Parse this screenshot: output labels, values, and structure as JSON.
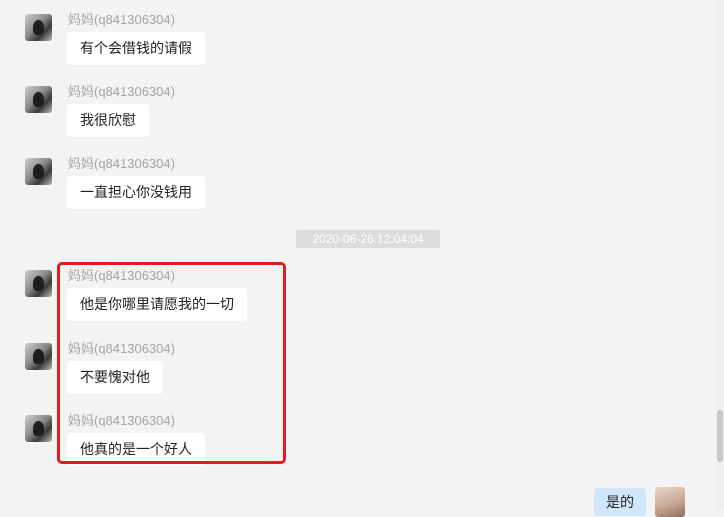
{
  "messages": [
    {
      "sender": "妈妈(q841306304)",
      "text": "有个会借钱的请假"
    },
    {
      "sender": "妈妈(q841306304)",
      "text": "我很欣慰"
    },
    {
      "sender": "妈妈(q841306304)",
      "text": "一直担心你没钱用"
    },
    {
      "sender": "妈妈(q841306304)",
      "text": "他是你哪里请愿我的一切"
    },
    {
      "sender": "妈妈(q841306304)",
      "text": "不要愧对他"
    },
    {
      "sender": "妈妈(q841306304)",
      "text": "他真的是一个好人"
    }
  ],
  "timestamp": "2020-06-26 12:04:04",
  "self_message": {
    "text": "是的"
  },
  "colors": {
    "highlight": "#e01d1d",
    "self_bubble": "#cfe6fb",
    "background": "#f3f3f3"
  }
}
